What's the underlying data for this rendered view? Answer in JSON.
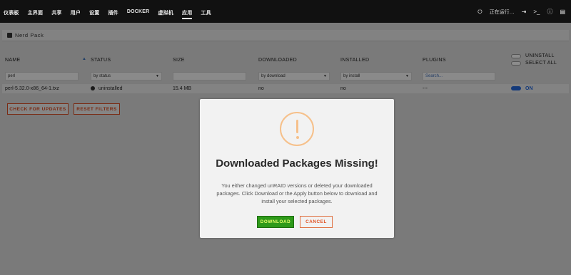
{
  "nav": {
    "items": [
      "仪表板",
      "主界面",
      "共享",
      "用户",
      "设置",
      "插件",
      "DOCKER",
      "虚拟机",
      "应用",
      "工具"
    ],
    "active_index": 8,
    "right_items": [
      "正在运行…",
      "注销",
      "终端",
      "信息",
      "日志"
    ]
  },
  "section": {
    "title": "Nerd Pack"
  },
  "table": {
    "headers": {
      "name": "NAME",
      "status": "STATUS",
      "size": "SIZE",
      "downloaded": "DOWNLOADED",
      "installed": "INSTALLED",
      "plugins": "PLUGINS"
    },
    "toggles": {
      "uninstall": "UNINSTALL",
      "select_all": "SELECT ALL"
    },
    "filters": {
      "name_value": "perl",
      "status": "by status",
      "downloaded": "by download",
      "installed": "by install",
      "plugins_placeholder": "Search..."
    },
    "row": {
      "name": "perl-5.32.0-x86_64-1.txz",
      "status": "uninstalled",
      "size": "15.4 MB",
      "downloaded": "no",
      "installed": "no",
      "plugins": "---",
      "toggle_label": "ON"
    }
  },
  "buttons": {
    "check_updates": "CHECK FOR UPDATES",
    "reset_filters": "RESET FILTERS"
  },
  "modal": {
    "title": "Downloaded Packages Missing!",
    "text": "You either changed unRAID versions or deleted your downloaded packages. Click Download or the Apply button below to download and install your selected packages.",
    "download": "DOWNLOAD",
    "cancel": "CANCEL"
  },
  "colors": {
    "warning": "#f6c08a",
    "download_bg": "#2e9a1a",
    "cancel_border": "#e07040"
  }
}
